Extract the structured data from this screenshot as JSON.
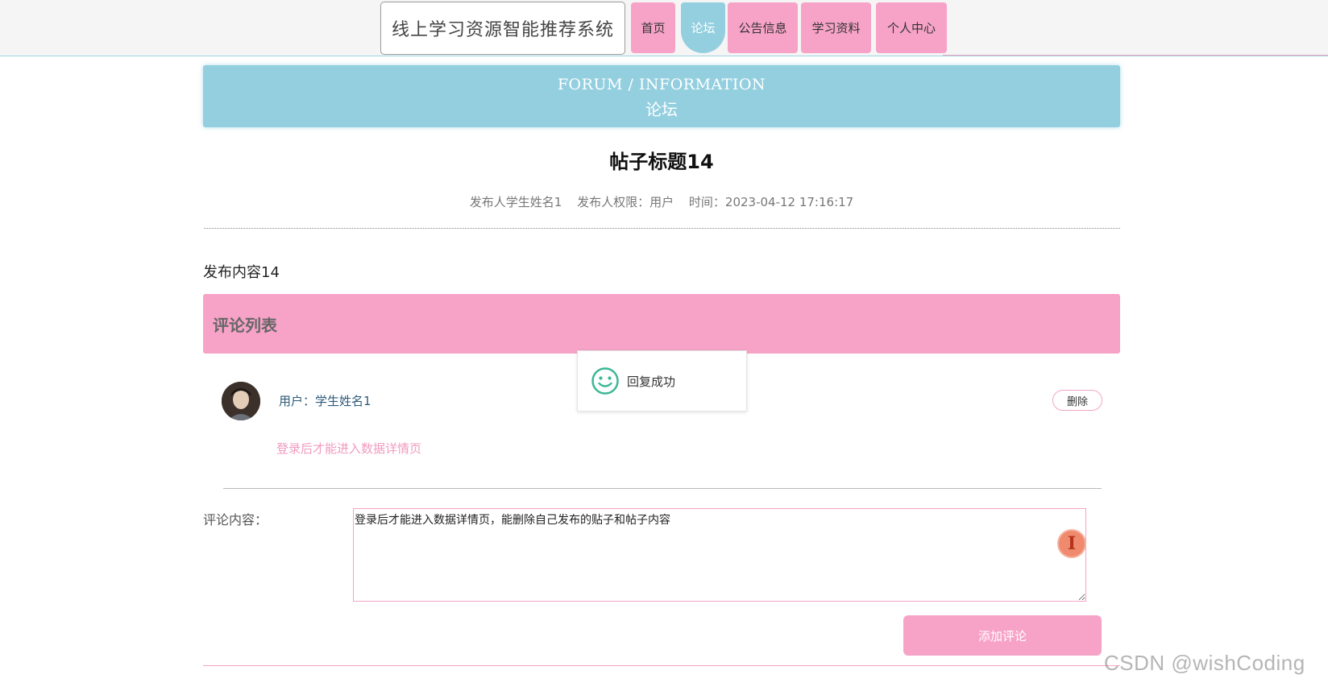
{
  "header": {
    "site_title": "线上学习资源智能推荐系统",
    "nav": [
      {
        "label": "首页",
        "active": false
      },
      {
        "label": "论坛",
        "active": true
      },
      {
        "label": "公告信息",
        "active": false
      },
      {
        "label": "学习资料",
        "active": false
      },
      {
        "label": "个人中心",
        "active": false
      }
    ]
  },
  "banner": {
    "en": "FORUM / INFORMATION",
    "zh": "论坛"
  },
  "post": {
    "title": "帖子标题14",
    "author": "发布人学生姓名1",
    "permission": "发布人权限：用户",
    "time": "时间：2023-04-12 17:16:17",
    "content": "发布内容14"
  },
  "comments": {
    "header": "评论列表",
    "items": [
      {
        "user": "用户：学生姓名1",
        "text": "登录后才能进入数据详情页",
        "delete_label": "删除"
      }
    ]
  },
  "toast": {
    "icon": "smile-icon",
    "message": "回复成功"
  },
  "form": {
    "label": "评论内容：",
    "value": "登录后才能进入数据详情页，能删除自己发布的贴子和帖子内容",
    "submit_label": "添加评论"
  },
  "watermark": "CSDN @wishCoding",
  "colors": {
    "pink": "#f7a3c8",
    "teal": "#93cfdf",
    "comment_text": "#f09bbf",
    "user_link": "#2e5b7a"
  }
}
